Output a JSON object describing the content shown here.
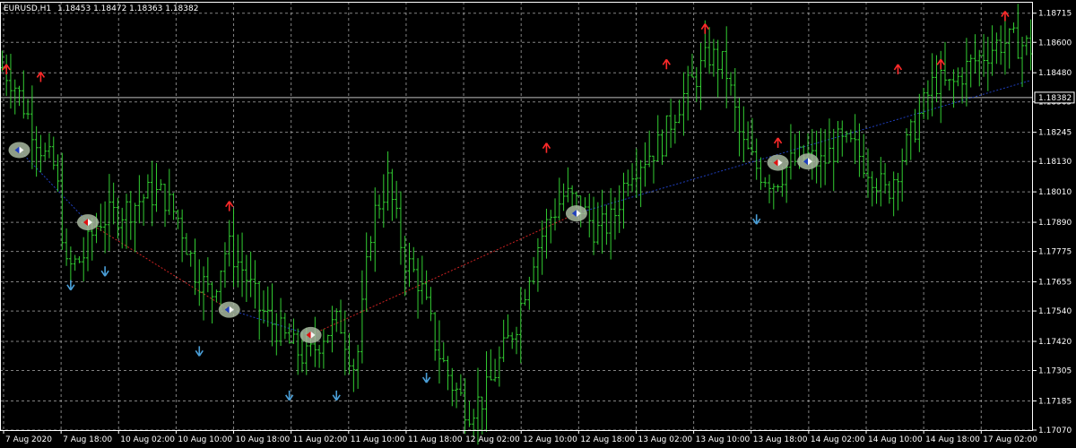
{
  "header": {
    "symbol": "EURUSD,H1",
    "ohlc": "1.18453 1.18472 1.18363 1.18382"
  },
  "price_label": "1.18382",
  "colors": {
    "background": "#000000",
    "bars": "#32cd32",
    "grid": "#c8c8c8",
    "axis": "#ffffff",
    "bid_line": "#c0c0c0",
    "up_arrow": "#ff2a2a",
    "down_arrow": "#4a9fd8",
    "trend_down": "#cc2222",
    "trend_up": "#1f3fbf",
    "signal_badge": "#a8b8a0"
  },
  "chart_data": {
    "type": "bar",
    "title": "EURUSD,H1",
    "price_axis": {
      "ticks": [
        "1.18715",
        "1.18600",
        "1.18480",
        "1.18365",
        "1.18245",
        "1.18130",
        "1.18010",
        "1.17890",
        "1.17775",
        "1.17655",
        "1.17540",
        "1.17420",
        "1.17305",
        "1.17185",
        "1.17070"
      ],
      "range": [
        1.1707,
        1.1876
      ]
    },
    "time_axis": {
      "ticks": [
        "7 Aug 2020",
        "7 Aug 18:00",
        "10 Aug 02:00",
        "10 Aug 10:00",
        "10 Aug 18:00",
        "11 Aug 02:00",
        "11 Aug 10:00",
        "11 Aug 18:00",
        "12 Aug 02:00",
        "12 Aug 10:00",
        "12 Aug 18:00",
        "13 Aug 02:00",
        "13 Aug 10:00",
        "13 Aug 18:00",
        "14 Aug 02:00",
        "14 Aug 10:00",
        "14 Aug 18:00",
        "17 Aug 02:00"
      ]
    },
    "current_price": 1.18382,
    "grid": true,
    "ohlc_anchors": [
      [
        0,
        1.185
      ],
      [
        2,
        1.1845
      ],
      [
        5,
        1.183
      ],
      [
        8,
        1.1815
      ],
      [
        10,
        1.181
      ],
      [
        12,
        1.177
      ],
      [
        15,
        1.1775
      ],
      [
        18,
        1.179
      ],
      [
        21,
        1.1792
      ],
      [
        24,
        1.1795
      ],
      [
        27,
        1.18
      ],
      [
        30,
        1.18
      ],
      [
        33,
        1.179
      ],
      [
        36,
        1.177
      ],
      [
        39,
        1.176
      ],
      [
        42,
        1.178
      ],
      [
        45,
        1.177
      ],
      [
        48,
        1.1755
      ],
      [
        51,
        1.1748
      ],
      [
        54,
        1.174
      ],
      [
        57,
        1.1735
      ],
      [
        60,
        1.1745
      ],
      [
        63,
        1.175
      ],
      [
        66,
        1.173
      ],
      [
        69,
        1.179
      ],
      [
        72,
        1.1805
      ],
      [
        75,
        1.1775
      ],
      [
        78,
        1.1765
      ],
      [
        81,
        1.174
      ],
      [
        84,
        1.1725
      ],
      [
        87,
        1.1715
      ],
      [
        90,
        1.172
      ],
      [
        93,
        1.1735
      ],
      [
        96,
        1.175
      ],
      [
        99,
        1.1775
      ],
      [
        102,
        1.179
      ],
      [
        105,
        1.18
      ],
      [
        108,
        1.1795
      ],
      [
        111,
        1.1785
      ],
      [
        114,
        1.179
      ],
      [
        117,
        1.181
      ],
      [
        120,
        1.1815
      ],
      [
        123,
        1.182
      ],
      [
        126,
        1.1835
      ],
      [
        129,
        1.1845
      ],
      [
        132,
        1.1855
      ],
      [
        135,
        1.185
      ],
      [
        138,
        1.182
      ],
      [
        141,
        1.181
      ],
      [
        144,
        1.1805
      ],
      [
        147,
        1.1812
      ],
      [
        150,
        1.1815
      ],
      [
        153,
        1.1812
      ],
      [
        156,
        1.182
      ],
      [
        159,
        1.1818
      ],
      [
        162,
        1.181
      ],
      [
        165,
        1.18
      ],
      [
        168,
        1.1815
      ],
      [
        171,
        1.183
      ],
      [
        174,
        1.1845
      ],
      [
        177,
        1.1842
      ],
      [
        180,
        1.185
      ],
      [
        183,
        1.1855
      ],
      [
        186,
        1.186
      ],
      [
        189,
        1.186
      ],
      [
        192,
        1.1858
      ]
    ],
    "up_arrows": [
      {
        "bar": 1,
        "price": 1.18495
      },
      {
        "bar": 9,
        "price": 1.18465
      },
      {
        "bar": 53,
        "price": 1.17955
      },
      {
        "bar": 127,
        "price": 1.18185
      },
      {
        "bar": 155,
        "price": 1.18515
      },
      {
        "bar": 164,
        "price": 1.18655
      },
      {
        "bar": 181,
        "price": 1.18205
      },
      {
        "bar": 209,
        "price": 1.18495
      },
      {
        "bar": 219,
        "price": 1.18515
      },
      {
        "bar": 234,
        "price": 1.18705
      }
    ],
    "down_arrows": [
      {
        "bar": 16,
        "price": 1.1764
      },
      {
        "bar": 24,
        "price": 1.17695
      },
      {
        "bar": 46,
        "price": 1.1738
      },
      {
        "bar": 67,
        "price": 1.17205
      },
      {
        "bar": 78,
        "price": 1.17205
      },
      {
        "bar": 99,
        "price": 1.17275
      },
      {
        "bar": 176,
        "price": 1.179
      }
    ],
    "signals": [
      {
        "bar": 4,
        "price": 1.18175,
        "dir": "blue"
      },
      {
        "bar": 20,
        "price": 1.1789,
        "dir": "red"
      },
      {
        "bar": 53,
        "price": 1.17545,
        "dir": "blue"
      },
      {
        "bar": 72,
        "price": 1.17445,
        "dir": "red"
      },
      {
        "bar": 134,
        "price": 1.17925,
        "dir": "blue"
      },
      {
        "bar": 181,
        "price": 1.18125,
        "dir": "red"
      },
      {
        "bar": 188,
        "price": 1.1813,
        "dir": "blue"
      }
    ],
    "trend_segments": [
      {
        "from_bar": 4,
        "from_price": 1.18175,
        "to_bar": 20,
        "to_price": 1.1789,
        "color": "trend_up"
      },
      {
        "from_bar": 20,
        "from_price": 1.1789,
        "to_bar": 53,
        "to_price": 1.17545,
        "color": "trend_down"
      },
      {
        "from_bar": 53,
        "from_price": 1.17545,
        "to_bar": 72,
        "to_price": 1.17445,
        "color": "trend_up"
      },
      {
        "from_bar": 72,
        "from_price": 1.17445,
        "to_bar": 134,
        "to_price": 1.17925,
        "color": "trend_down"
      },
      {
        "from_bar": 134,
        "from_price": 1.17925,
        "to_bar": 240,
        "to_price": 1.1845,
        "color": "trend_up"
      }
    ]
  }
}
